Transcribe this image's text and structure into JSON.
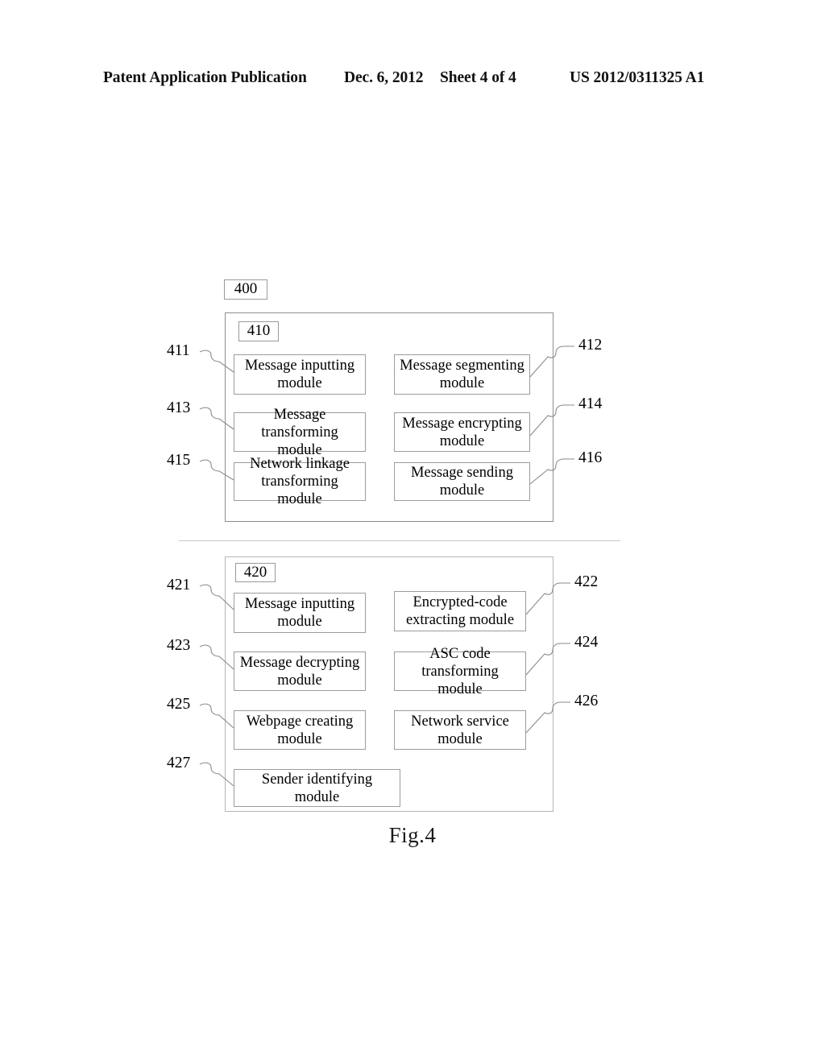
{
  "header": {
    "publication_label": "Patent Application Publication",
    "date": "Dec. 6, 2012",
    "sheet": "Sheet 4 of 4",
    "publication_number": "US 2012/0311325 A1"
  },
  "figure": {
    "caption": "Fig.4",
    "system_tag": "400",
    "sections": [
      {
        "tag": "410",
        "modules": [
          {
            "ref": "411",
            "label": "Message inputting module",
            "side": "left"
          },
          {
            "ref": "412",
            "label": "Message segmenting module",
            "side": "right"
          },
          {
            "ref": "413",
            "label": "Message transforming module",
            "side": "left"
          },
          {
            "ref": "414",
            "label": "Message encrypting module",
            "side": "right"
          },
          {
            "ref": "415",
            "label": "Network linkage transforming module",
            "side": "left"
          },
          {
            "ref": "416",
            "label": "Message sending module",
            "side": "right"
          }
        ]
      },
      {
        "tag": "420",
        "modules": [
          {
            "ref": "421",
            "label": "Message inputting module",
            "side": "left"
          },
          {
            "ref": "422",
            "label": "Encrypted-code extracting module",
            "side": "right"
          },
          {
            "ref": "423",
            "label": "Message decrypting module",
            "side": "left"
          },
          {
            "ref": "424",
            "label": "ASC code transforming module",
            "side": "right"
          },
          {
            "ref": "425",
            "label": "Webpage creating module",
            "side": "left"
          },
          {
            "ref": "426",
            "label": "Network service module",
            "side": "right"
          },
          {
            "ref": "427",
            "label": "Sender identifying module",
            "side": "left"
          }
        ]
      }
    ]
  },
  "colors": {
    "ink": "#000000",
    "line": "#8a8a8a",
    "line_light": "#b5b5b5",
    "background": "#ffffff"
  }
}
